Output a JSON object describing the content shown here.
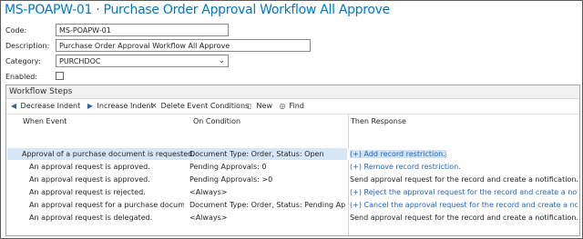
{
  "title": "MS-POAPW-01 · Purchase Order Approval Workflow All Approve",
  "form": {
    "code_label": "Code:",
    "code_value": "MS-POAPW-01",
    "description_label": "Description:",
    "description_value": "Purchase Order Approval Workflow All Approve",
    "category_label": "Category:",
    "category_value": "PURCHDOC",
    "enabled_label": "Enabled:",
    "enabled": false
  },
  "steps": {
    "header": "Workflow Steps",
    "toolbar": {
      "decrease": "Decrease Indent",
      "increase": "Increase Indent",
      "delete": "Delete Event Conditions",
      "new": "New",
      "find": "Find"
    },
    "columns": {
      "when": "When Event",
      "on": "On Condition",
      "then": "Then Response"
    },
    "rows": [
      {
        "when": "Approval of a purchase document is requested.",
        "on": "Document Type: Order, Status: Open",
        "then": "(+) Add record restriction."
      },
      {
        "when": "An approval request is approved.",
        "on": "Pending Approvals: 0",
        "then": "(+) Remove record restriction."
      },
      {
        "when": "An approval request is approved.",
        "on": "Pending Approvals: >0",
        "then": "Send approval request for the record and create a notification."
      },
      {
        "when": "An approval request is rejected.",
        "on": "<Always>",
        "then": "(+) Reject the approval request for the record and create a notification."
      },
      {
        "when": "An approval request for a purchase document i...",
        "on": "Document Type: Order, Status: Pending Appro...",
        "then": "(+) Cancel the approval request for the record and create a notification."
      },
      {
        "when": "An approval request is delegated.",
        "on": "<Always>",
        "then": "Send approval request for the record and create a notification."
      }
    ]
  },
  "colors": {
    "title": "#0078c8",
    "link": "#2566b8",
    "selection": "#d5e7f7"
  },
  "icons": [
    "triangle-left-icon",
    "triangle-right-icon",
    "delete-x-icon",
    "new-document-icon",
    "binoculars-icon",
    "chevron-down-icon"
  ]
}
